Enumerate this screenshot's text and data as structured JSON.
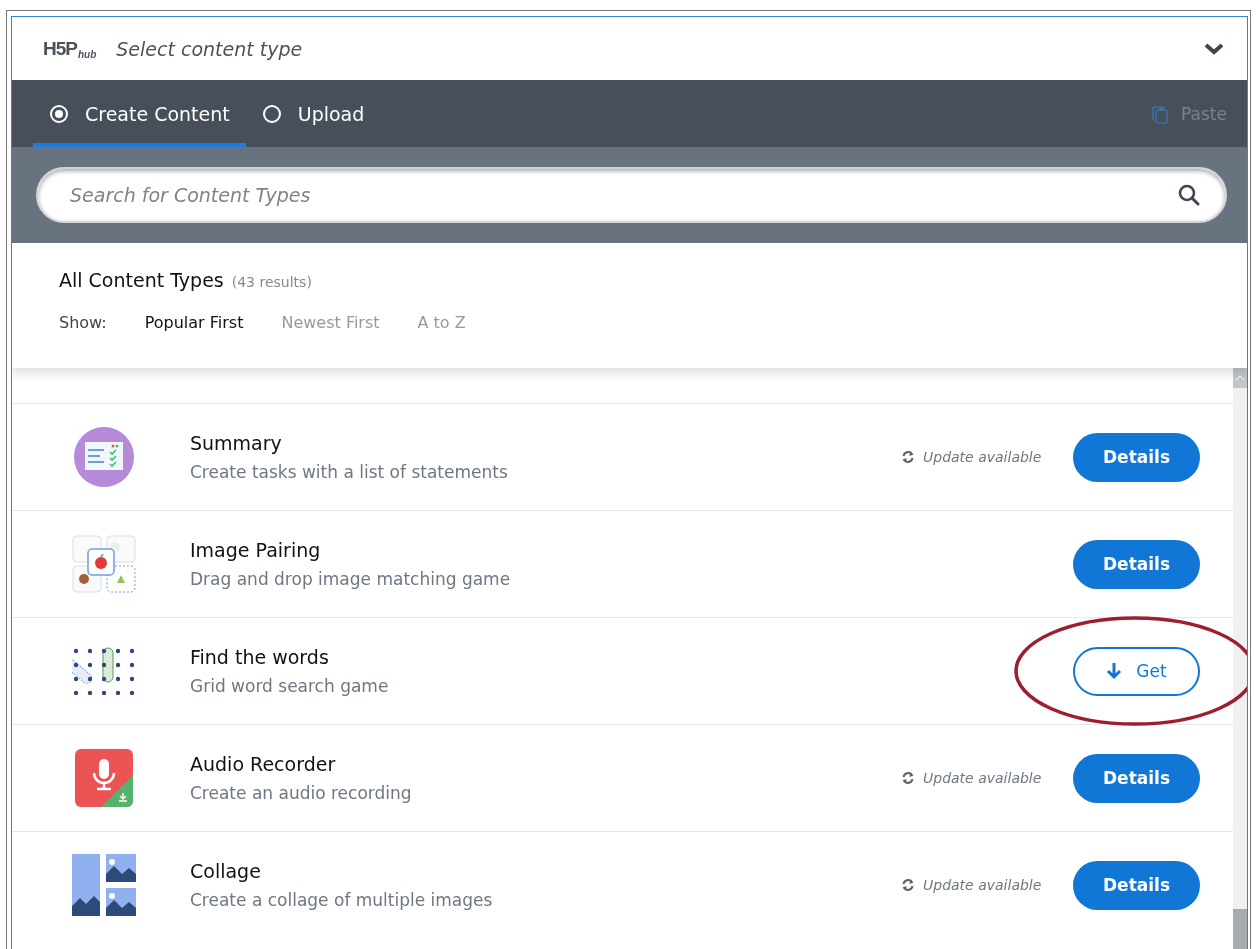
{
  "header": {
    "logo": {
      "mark": "H5P",
      "suffix": "hub"
    },
    "title": "Select content type",
    "expanded": true
  },
  "tabs": [
    {
      "label": "Create Content",
      "selected": true
    },
    {
      "label": "Upload",
      "selected": false
    }
  ],
  "paste": {
    "label": "Paste",
    "disabled": true
  },
  "search": {
    "placeholder": "Search for Content Types"
  },
  "results": {
    "heading": "All Content Types",
    "count": "(43 results)",
    "show_label": "Show:",
    "sort_options": [
      {
        "label": "Popular First",
        "selected": true
      },
      {
        "label": "Newest First",
        "selected": false
      },
      {
        "label": "A to Z",
        "selected": false
      }
    ]
  },
  "items": [
    {
      "kind": "summary",
      "name": "Summary",
      "description": "Create tasks with a list of statements",
      "update": "Update available",
      "button": {
        "kind": "details",
        "label": "Details"
      }
    },
    {
      "kind": "pairing",
      "name": "Image Pairing",
      "description": "Drag and drop image matching game",
      "button": {
        "kind": "details",
        "label": "Details"
      }
    },
    {
      "kind": "words",
      "name": "Find the words",
      "description": "Grid word search game",
      "button": {
        "kind": "get",
        "label": "Get"
      },
      "highlighted": true
    },
    {
      "kind": "audio",
      "name": "Audio Recorder",
      "description": "Create an audio recording",
      "update": "Update available",
      "button": {
        "kind": "details",
        "label": "Details"
      }
    },
    {
      "kind": "collage",
      "name": "Collage",
      "description": "Create a collage of multiple images",
      "update": "Update available",
      "button": {
        "kind": "details",
        "label": "Details"
      }
    }
  ]
}
